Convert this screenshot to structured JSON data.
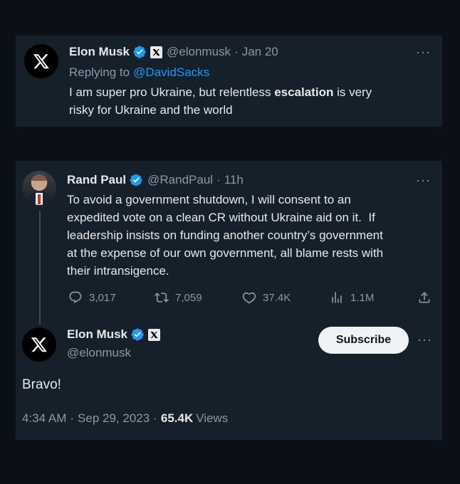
{
  "tweet1": {
    "name": "Elon Musk",
    "handle": "@elonmusk",
    "separator": "·",
    "date": "Jan 20",
    "replying_prefix": "Replying to",
    "replying_to": "@DavidSacks",
    "text_before": "I am super pro Ukraine, but relentless ",
    "text_bold": "escalation",
    "text_after_line1": " is very",
    "text_line2": "risky for Ukraine and the world",
    "more": "···"
  },
  "tweet2": {
    "name": "Rand Paul",
    "handle": "@RandPaul",
    "separator": "·",
    "time": "11h",
    "lines": [
      "To avoid a government shutdown, I will consent to an",
      "expedited vote on a clean CR without Ukraine aid on it.  If",
      "leadership insists on funding another country’s government",
      "at the expense of our own government, all blame rests with",
      "their intransigence."
    ],
    "replies": "3,017",
    "reposts": "7,059",
    "likes": "37.4K",
    "views": "1.1M",
    "more": "···"
  },
  "tweet3": {
    "name": "Elon Musk",
    "handle": "@elonmusk",
    "subscribe_label": "Subscribe",
    "text": "Bravo!",
    "time": "4:34 AM",
    "separator": "·",
    "date": "Sep 29, 2023",
    "separator2": "·",
    "views_count": "65.4K",
    "views_label": "Views",
    "more": "···"
  },
  "colors": {
    "background": "#0a1016",
    "card": "#15202b",
    "text": "#e7e9ea",
    "muted": "#8b98a5",
    "link": "#1d9bf0",
    "verified": "#1d9bf0"
  },
  "icons": [
    "x-logo-icon",
    "verified-badge-icon",
    "x-affiliation-icon",
    "reply-icon",
    "repost-icon",
    "like-icon",
    "views-icon",
    "share-icon",
    "more-icon"
  ]
}
